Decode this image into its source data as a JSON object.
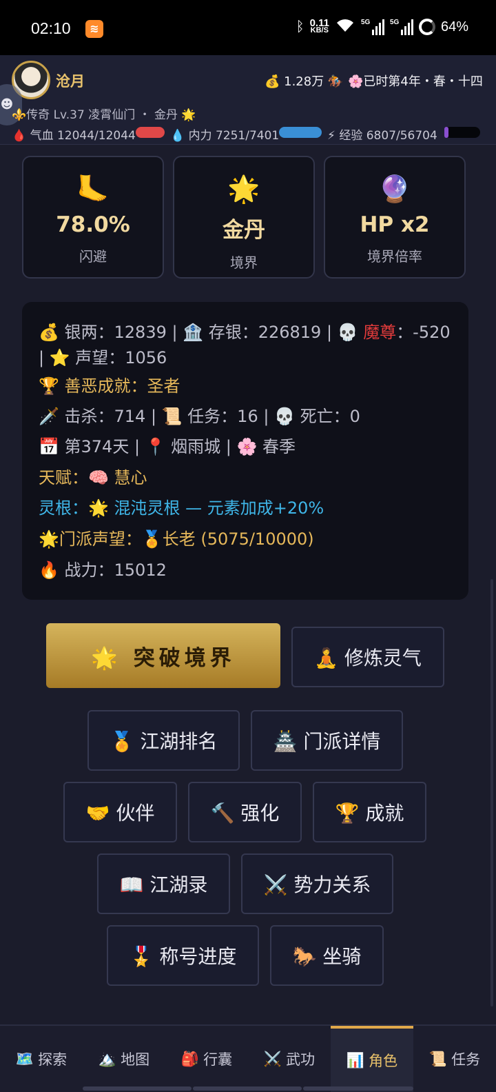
{
  "status_bar": {
    "time": "02:10",
    "speed_value": "0.11",
    "speed_unit": "KB/S",
    "battery": "64%",
    "net1": "5G",
    "net2": "5G"
  },
  "header": {
    "name": "沧月",
    "money": "💰 1.28万 🏇",
    "date": "🌸已时第4年・春・十四",
    "rank_line": "⚜️传奇 Lv.37 凌霄仙门 ・ 金丹 🌟",
    "hp_label": "🩸 气血 12044/12044",
    "mp_label": "💧 内力 7251/7401",
    "exp_label": "⚡ 经验 6807/56704",
    "hp_fill": 1.0,
    "mp_fill": 0.98,
    "exp_fill": 0.12
  },
  "stat_cards": [
    {
      "icon": "🦶",
      "value": "78.0%",
      "label": "闪避"
    },
    {
      "icon": "🌟",
      "value": "金丹",
      "label": "境界"
    },
    {
      "icon": "🔮",
      "value": "HP x2",
      "label": "境界倍率"
    }
  ],
  "info": {
    "silver": "💰 银两：12839 | 🏦 存银：226819 | 💀 ",
    "demon_title": "魔尊",
    "demon_value": "：-520",
    "fame": "| ⭐ 声望：1056",
    "morality": "🏆 善恶成就：圣者",
    "combat": "🗡️ 击杀：714 | 📜 任务：16 | 💀 死亡：0",
    "day_loc": "📅 第374天 | 📍 烟雨城 | 🌸 春季",
    "talent": "天赋：🧠 慧心",
    "root": "灵根：🌟 混沌灵根 — 元素加成+20%",
    "sect_fame": "🌟门派声望：🏅长老 (5075/10000)",
    "power": "🔥 战力：15012"
  },
  "actions": {
    "breakthrough": "🌟 突破境界",
    "cultivate": "🧘 修炼灵气",
    "ranking": "🏅 江湖排名",
    "sect": "🏯 门派详情",
    "partner": "🤝 伙伴",
    "enhance": "🔨 强化",
    "achieve": "🏆 成就",
    "records": "📖 江湖录",
    "relations": "⚔️ 势力关系",
    "title_progress": "🎖️ 称号进度",
    "mount": "🐎 坐骑"
  },
  "nav": [
    {
      "icon": "🗺️",
      "label": "探索"
    },
    {
      "icon": "🏔️",
      "label": "地图"
    },
    {
      "icon": "🎒",
      "label": "行囊"
    },
    {
      "icon": "⚔️",
      "label": "武功"
    },
    {
      "icon": "📊",
      "label": "角色"
    },
    {
      "icon": "📜",
      "label": "任务"
    }
  ],
  "colors": {
    "accent_gold": "#e6b85a",
    "hp": "#e04848",
    "mp": "#3a8fd6",
    "exp": "#8a4fd0",
    "root_cyan": "#3fb6e8"
  }
}
